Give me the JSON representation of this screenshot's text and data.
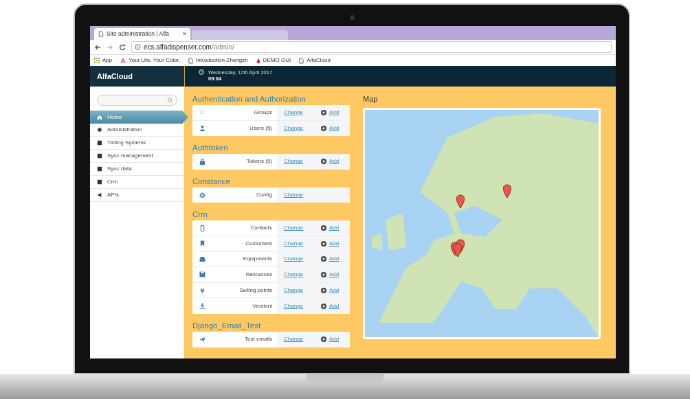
{
  "browser": {
    "tabs": [
      {
        "title": "Site administration | Alfa",
        "close": "×",
        "selected": true
      },
      {
        "selected": false
      }
    ],
    "address": {
      "host": "ecs.alfadispenser.com",
      "path": "/admin/"
    },
    "bookmarks": [
      "App",
      "Your Life, Your Color,",
      "Introduction-Zhengzh",
      "DEMO GUI",
      "AlfaCloud"
    ]
  },
  "header": {
    "brand": "AlfaCloud",
    "date": "Wednesday, 12th April 2017",
    "time": "09:04"
  },
  "sidebar": {
    "items": [
      {
        "label": "Home",
        "selected": true
      },
      {
        "label": "Administration",
        "selected": false
      },
      {
        "label": "Tinting Systems",
        "selected": false
      },
      {
        "label": "Sync management",
        "selected": false
      },
      {
        "label": "Sync data",
        "selected": false
      },
      {
        "label": "Crm",
        "selected": false
      },
      {
        "label": "APIs",
        "selected": false
      }
    ]
  },
  "apps": [
    {
      "title": "Authentication and Authorization",
      "models": [
        {
          "name": "Groups",
          "change": "Change",
          "add": "Add"
        },
        {
          "name": "Users (5)",
          "change": "Change",
          "add": "Add"
        }
      ]
    },
    {
      "title": "Authtoken",
      "models": [
        {
          "name": "Tokens (5)",
          "change": "Change",
          "add": "Add"
        }
      ]
    },
    {
      "title": "Constance",
      "models": [
        {
          "name": "Config",
          "change": "Change"
        }
      ]
    },
    {
      "title": "Crm",
      "models": [
        {
          "name": "Contacts",
          "change": "Change",
          "add": "Add"
        },
        {
          "name": "Customers",
          "change": "Change",
          "add": "Add"
        },
        {
          "name": "Equipments",
          "change": "Change",
          "add": "Add"
        },
        {
          "name": "Resources",
          "change": "Change",
          "add": "Add"
        },
        {
          "name": "Selling points",
          "change": "Change",
          "add": "Add"
        },
        {
          "name": "Versioni",
          "change": "Change",
          "add": "Add"
        }
      ]
    },
    {
      "title": "Django_Email_Test",
      "models": [
        {
          "name": "Test emails",
          "change": "Change",
          "add": "Add"
        }
      ]
    }
  ],
  "map": {
    "title": "Map"
  }
}
